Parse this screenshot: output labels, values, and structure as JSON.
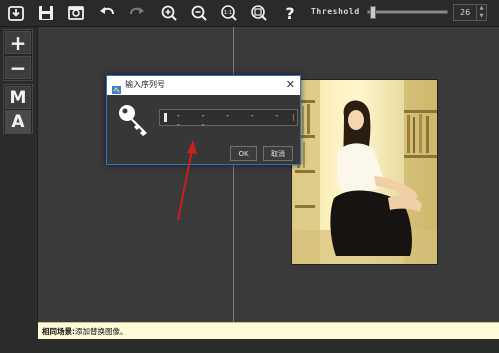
{
  "toolbar": {
    "buttons": [
      {
        "name": "import-icon"
      },
      {
        "name": "save-icon"
      },
      {
        "name": "preview-icon"
      },
      {
        "name": "undo-icon"
      },
      {
        "name": "redo-icon"
      },
      {
        "name": "zoom-in-icon"
      },
      {
        "name": "zoom-out-icon"
      },
      {
        "name": "actual-size-icon",
        "label": "1:1"
      },
      {
        "name": "fit-icon"
      },
      {
        "name": "help-icon",
        "label": "?"
      }
    ],
    "threshold_label": "Threshold",
    "threshold_value": "26",
    "threshold_fraction": 0.04
  },
  "sidebar": {
    "add_label": "+",
    "remove_label": "−",
    "mode_m_label": "M",
    "mode_a_label": "A"
  },
  "dialog": {
    "title": "输入序列号",
    "close_label": "✕",
    "serial_mask": "- - - - - - -",
    "ok_label": "OK",
    "cancel_label": "取消"
  },
  "status": {
    "label": "相同场景:",
    "message": "添加替换图像。"
  },
  "colors": {
    "accent_border": "#2a73c7",
    "annotation_arrow": "#c8201a",
    "status_bg": "#fffbd8"
  }
}
